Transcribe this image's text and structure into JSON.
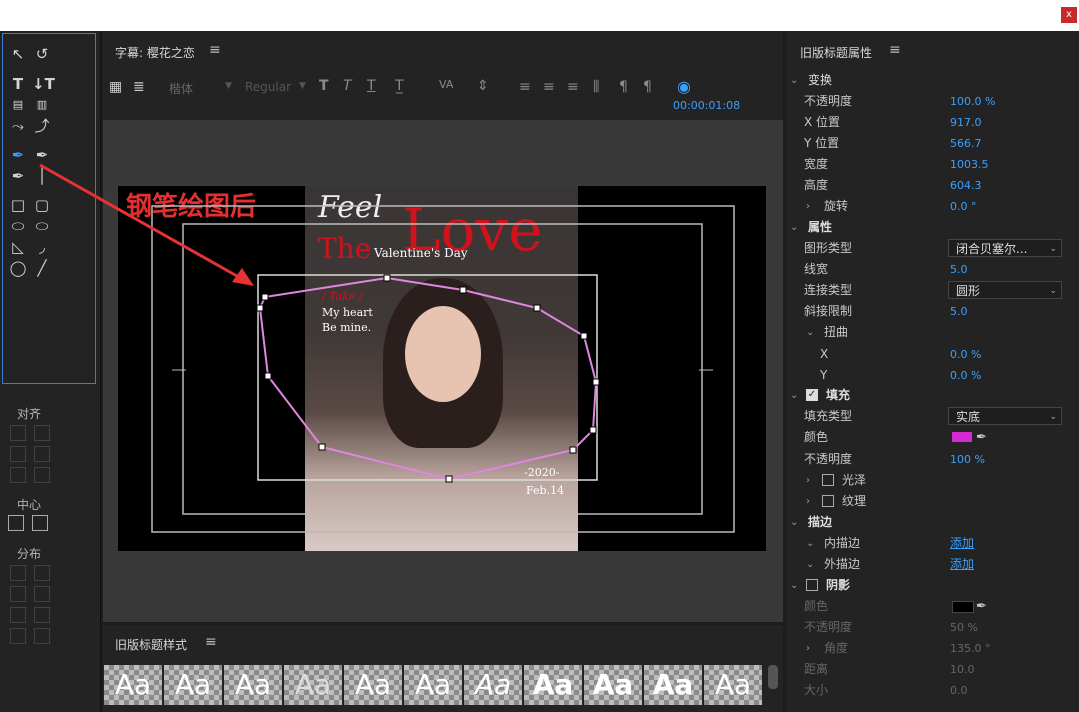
{
  "window": {
    "close_label": "x"
  },
  "tools": {
    "align_label": "对齐",
    "center_label": "中心",
    "distribute_label": "分布"
  },
  "title_panel": {
    "title": "字幕: 樱花之恋",
    "font_family": "楷体",
    "font_style": "Regular",
    "timecode": "00:00:01:08"
  },
  "canvas": {
    "annotation": "钢笔绘图后",
    "text_feel": "Feel",
    "text_love": "Love",
    "text_the": "The",
    "text_valentine": "Valentine's Day",
    "text_take": "/ Take /",
    "text_myheart": "My heart",
    "text_bemine": "Be mine.",
    "text_year": "-2020-",
    "text_date": "Feb.14"
  },
  "styles_panel": {
    "title": "旧版标题样式",
    "swatches": [
      "Aa",
      "Aa",
      "Aa",
      "Aa",
      "Aa",
      "Aa",
      "Aa",
      "Aa",
      "Aa",
      "Aa",
      "Aa"
    ]
  },
  "props": {
    "title": "旧版标题属性",
    "transform": {
      "label": "变换",
      "opacity_label": "不透明度",
      "opacity": "100.0 %",
      "x_label": "X 位置",
      "x": "917.0",
      "y_label": "Y 位置",
      "y": "566.7",
      "width_label": "宽度",
      "width": "1003.5",
      "height_label": "高度",
      "height": "604.3",
      "rotate_label": "旋转",
      "rotate": "0.0 °"
    },
    "attributes": {
      "label": "属性",
      "graphic_type_label": "图形类型",
      "graphic_type": "闭合贝塞尔...",
      "line_width_label": "线宽",
      "line_width": "5.0",
      "join_type_label": "连接类型",
      "join_type": "圆形",
      "miter_label": "斜接限制",
      "miter": "5.0",
      "distort_label": "扭曲",
      "dx_label": "X",
      "dx": "0.0 %",
      "dy_label": "Y",
      "dy": "0.0 %"
    },
    "fill": {
      "label": "填充",
      "fill_type_label": "填充类型",
      "fill_type": "实底",
      "color_label": "颜色",
      "color": "#d42bd4",
      "opacity_label": "不透明度",
      "opacity": "100 %",
      "sheen_label": "光泽",
      "texture_label": "纹理"
    },
    "stroke": {
      "label": "描边",
      "inner_label": "内描边",
      "inner_action": "添加",
      "outer_label": "外描边",
      "outer_action": "添加"
    },
    "shadow": {
      "label": "阴影",
      "color_label": "颜色",
      "color": "#000000",
      "opacity_label": "不透明度",
      "opacity": "50 %",
      "angle_label": "角度",
      "angle": "135.0 °",
      "distance_label": "距离",
      "distance": "10.0",
      "size_label": "大小",
      "size": "0.0"
    }
  }
}
